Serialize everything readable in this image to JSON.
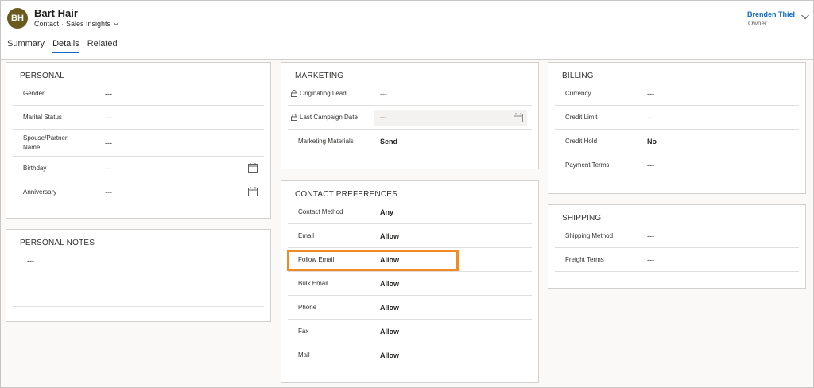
{
  "header": {
    "avatar_initials": "BH",
    "record_name": "Bart Hair",
    "record_type": "Contact",
    "separator": "·",
    "form_name": "Sales Insights",
    "owner_name": "Brenden Thiel",
    "owner_label": "Owner"
  },
  "tabs": [
    {
      "label": "Summary"
    },
    {
      "label": "Details",
      "active": true
    },
    {
      "label": "Related"
    }
  ],
  "personal": {
    "title": "PERSONAL",
    "rows": [
      {
        "label": "Gender",
        "value": "---"
      },
      {
        "label": "Marital Status",
        "value": "---"
      },
      {
        "label": "Spouse/Partner Name",
        "value": "---"
      },
      {
        "label": "Birthday",
        "value": "---"
      },
      {
        "label": "Anniversary",
        "value": "---"
      }
    ]
  },
  "personal_notes": {
    "title": "PERSONAL NOTES",
    "value": "---"
  },
  "marketing": {
    "title": "MARKETING",
    "rows": [
      {
        "label": "Originating Lead",
        "value": "---"
      },
      {
        "label": "Last Campaign Date",
        "value": "---"
      },
      {
        "label": "Marketing Materials",
        "value": "Send"
      }
    ]
  },
  "contact_preferences": {
    "title": "CONTACT PREFERENCES",
    "rows": [
      {
        "label": "Contact Method",
        "value": "Any"
      },
      {
        "label": "Email",
        "value": "Allow"
      },
      {
        "label": "Follow Email",
        "value": "Allow"
      },
      {
        "label": "Bulk Email",
        "value": "Allow"
      },
      {
        "label": "Phone",
        "value": "Allow"
      },
      {
        "label": "Fax",
        "value": "Allow"
      },
      {
        "label": "Mail",
        "value": "Allow"
      }
    ]
  },
  "billing": {
    "title": "BILLING",
    "rows": [
      {
        "label": "Currency",
        "value": "---"
      },
      {
        "label": "Credit Limit",
        "value": "---"
      },
      {
        "label": "Credit Hold",
        "value": "No"
      },
      {
        "label": "Payment Terms",
        "value": "---"
      }
    ]
  },
  "shipping": {
    "title": "SHIPPING",
    "rows": [
      {
        "label": "Shipping Method",
        "value": "---"
      },
      {
        "label": "Freight Terms",
        "value": "---"
      }
    ]
  },
  "colors": {
    "accent": "#0f6cbd",
    "avatar": "#6b5a1e",
    "highlight": "#f08a24"
  }
}
